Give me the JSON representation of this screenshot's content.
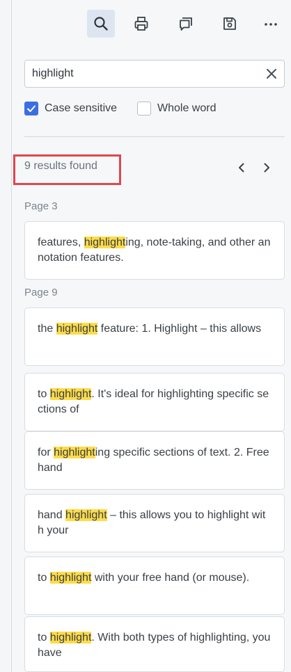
{
  "search": {
    "value": "highlight",
    "options": [
      {
        "label": "Case sensitive",
        "checked": true
      },
      {
        "label": "Whole word",
        "checked": false
      }
    ]
  },
  "results": {
    "count_text": "9 results found",
    "groups": [
      {
        "page": "Page 3",
        "items": [
          {
            "before": "features, ",
            "match": "highlight",
            "after": "ing, note-taking, and other annotation features."
          }
        ]
      },
      {
        "page": "Page 9",
        "items": [
          {
            "before": "the ",
            "match": "highlight",
            "after": " feature: 1. Highlight – this allows"
          },
          {
            "before": "to ",
            "match": "highlight",
            "after": ". It's ideal for highlighting specific sections of"
          },
          {
            "before": "for ",
            "match": "highlight",
            "after": "ing specific sections of text. 2. Free hand"
          },
          {
            "before": "hand ",
            "match": "highlight",
            "after": " – this allows you to highlight with your"
          },
          {
            "before": "to ",
            "match": "highlight",
            "after": " with your free hand (or mouse)."
          },
          {
            "before": "to ",
            "match": "highlight",
            "after": ". With both types of highlighting, you have"
          }
        ]
      }
    ]
  },
  "icons": {
    "toolbar": [
      "search-icon",
      "print-icon",
      "comment-icon",
      "save-icon",
      "more-icon"
    ],
    "clear": "close-icon",
    "prev": "chevron-left-icon",
    "next": "chevron-right-icon",
    "check": "checkmark-icon"
  },
  "colors": {
    "accent": "#3b6ee3",
    "highlight": "#fddc4a",
    "annotation_frame": "#e0474c"
  }
}
